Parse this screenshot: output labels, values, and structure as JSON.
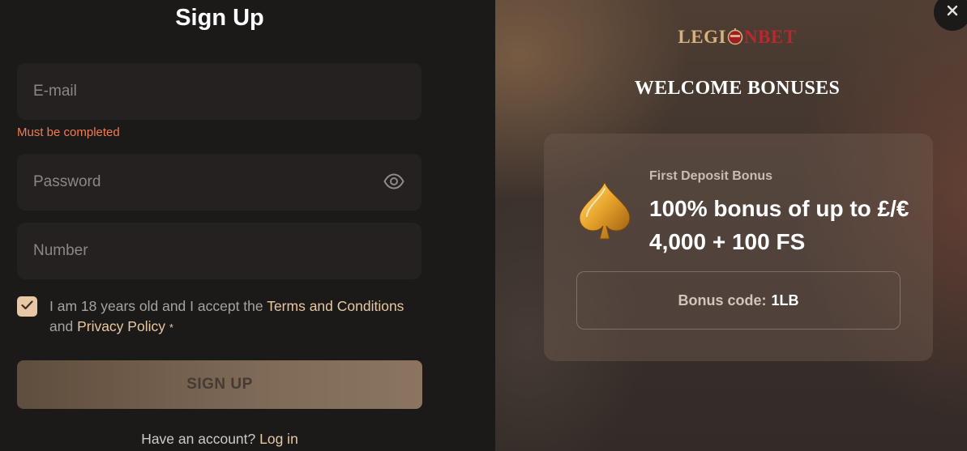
{
  "signup": {
    "title": "Sign Up",
    "email_placeholder": "E-mail",
    "email_error": "Must be completed",
    "password_placeholder": "Password",
    "number_placeholder": "Number",
    "terms_prefix": "I am 18 years old and I accept the ",
    "terms_link": "Terms and Conditions",
    "terms_and": "and ",
    "privacy_link": "Privacy Policy",
    "required_mark": "*",
    "terms_checked": true,
    "button_label": "SIGN UP",
    "have_account": "Have an account? ",
    "login_link": "Log in"
  },
  "promo": {
    "logo_left": "LEGI",
    "logo_right": "NBET",
    "welcome": "WELCOME BONUSES",
    "bonus_label": "First Deposit Bonus",
    "bonus_title": "100% bonus of up to £/€ 4,000 + 100 FS",
    "code_label": "Bonus code:",
    "code_value": "1LB"
  },
  "icons": {
    "eye": "eye-icon",
    "check": "check-icon",
    "spade": "spade-icon",
    "close": "close-icon",
    "logo_helmet": "helmet-icon"
  },
  "colors": {
    "accent": "#e7c8a2",
    "error": "#f07c52",
    "logo_red": "#b8282e",
    "logo_gold": "#d8b07c"
  }
}
